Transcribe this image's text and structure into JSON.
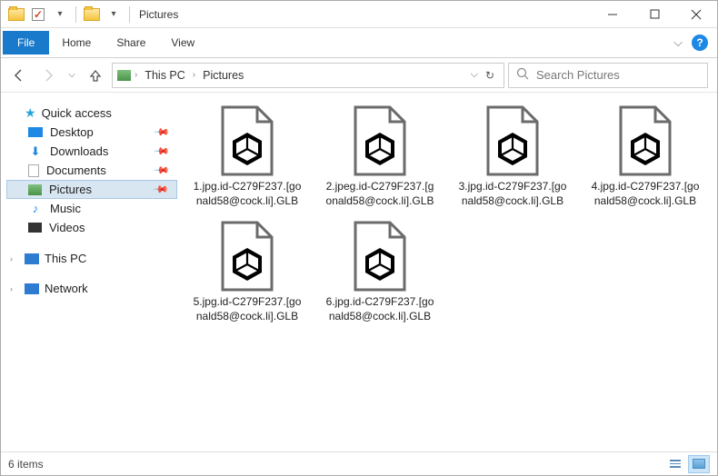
{
  "window": {
    "title": "Pictures"
  },
  "ribbon": {
    "file": "File",
    "tabs": [
      "Home",
      "Share",
      "View"
    ]
  },
  "breadcrumb": {
    "items": [
      "This PC",
      "Pictures"
    ]
  },
  "search": {
    "placeholder": "Search Pictures"
  },
  "sidebar": {
    "quick_access": "Quick access",
    "items": [
      {
        "label": "Desktop",
        "pinned": true
      },
      {
        "label": "Downloads",
        "pinned": true
      },
      {
        "label": "Documents",
        "pinned": true
      },
      {
        "label": "Pictures",
        "pinned": true,
        "selected": true
      },
      {
        "label": "Music",
        "pinned": false
      },
      {
        "label": "Videos",
        "pinned": false
      }
    ],
    "this_pc": "This PC",
    "network": "Network"
  },
  "files": [
    {
      "name": "1.jpg.id-C279F237.[gonald58@cock.li].GLB"
    },
    {
      "name": "2.jpeg.id-C279F237.[gonald58@cock.li].GLB"
    },
    {
      "name": "3.jpg.id-C279F237.[gonald58@cock.li].GLB"
    },
    {
      "name": "4.jpg.id-C279F237.[gonald58@cock.li].GLB"
    },
    {
      "name": "5.jpg.id-C279F237.[gonald58@cock.li].GLB"
    },
    {
      "name": "6.jpg.id-C279F237.[gonald58@cock.li].GLB"
    }
  ],
  "status": {
    "count_label": "6 items"
  }
}
